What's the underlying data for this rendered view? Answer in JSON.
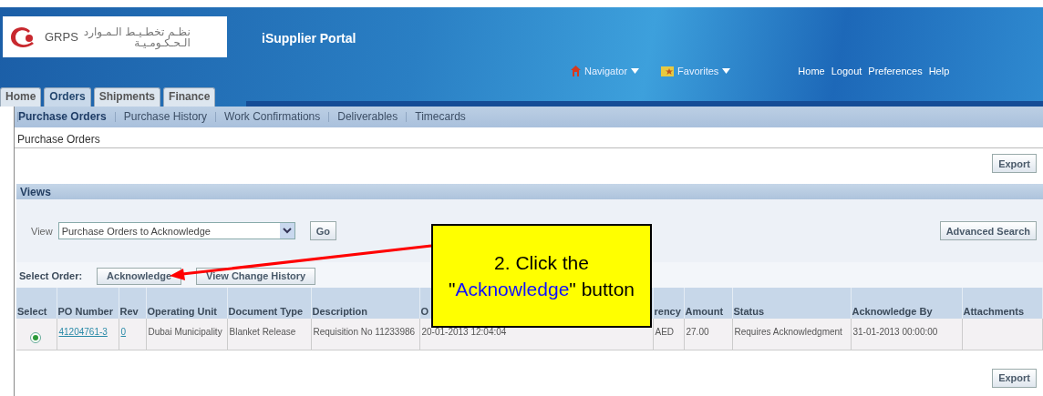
{
  "header": {
    "logo": {
      "latin": "GRPS",
      "arabic_top": "نظـم تخطـيـط الـمـوارد",
      "arabic_bottom": "الـحـكـومـيـة"
    },
    "app_title": "iSupplier Portal",
    "global_menus": [
      {
        "label": "Navigator",
        "kind": "navigator"
      },
      {
        "label": "Favorites",
        "kind": "favorites"
      }
    ],
    "global_links": [
      "Home",
      "Logout",
      "Preferences",
      "Help"
    ]
  },
  "tabs": [
    {
      "label": "Home",
      "selected": false
    },
    {
      "label": "Orders",
      "selected": true
    },
    {
      "label": "Shipments",
      "selected": false
    },
    {
      "label": "Finance",
      "selected": false
    }
  ],
  "subtabs": [
    {
      "label": "Purchase Orders",
      "selected": true
    },
    {
      "label": "Purchase History",
      "selected": false
    },
    {
      "label": "Work Confirmations",
      "selected": false
    },
    {
      "label": "Deliverables",
      "selected": false
    },
    {
      "label": "Timecards",
      "selected": false
    }
  ],
  "page_title": "Purchase Orders",
  "export_top": "Export",
  "views": {
    "title": "Views",
    "label": "View",
    "value": "Purchase Orders to Acknowledge",
    "go": "Go",
    "advanced_search": "Advanced Search"
  },
  "select_order": {
    "label": "Select Order:",
    "buttons": [
      "Acknowledge",
      "View Change History"
    ]
  },
  "table": {
    "columns": [
      "Select",
      "PO Number",
      "Rev",
      "Operating Unit",
      "Document Type",
      "Description",
      "O",
      "rency",
      "Amount",
      "Status",
      "Acknowledge By",
      "Attachments"
    ],
    "rows": [
      {
        "selected": true,
        "po_number": "41204761-3",
        "rev": "0",
        "operating_unit": "Dubai Municipality",
        "document_type": "Blanket Release",
        "description": "Requisition No 11233986",
        "order_date": "20-01-2013 12:04:04",
        "currency": "AED",
        "amount": "27.00",
        "status": "Requires Acknowledgment",
        "acknowledge_by": "31-01-2013 00:00:00"
      }
    ]
  },
  "export_bottom": "Export",
  "callout": {
    "before": "2. Click the \"",
    "highlight": "Acknowledge",
    "after": "\" button"
  }
}
